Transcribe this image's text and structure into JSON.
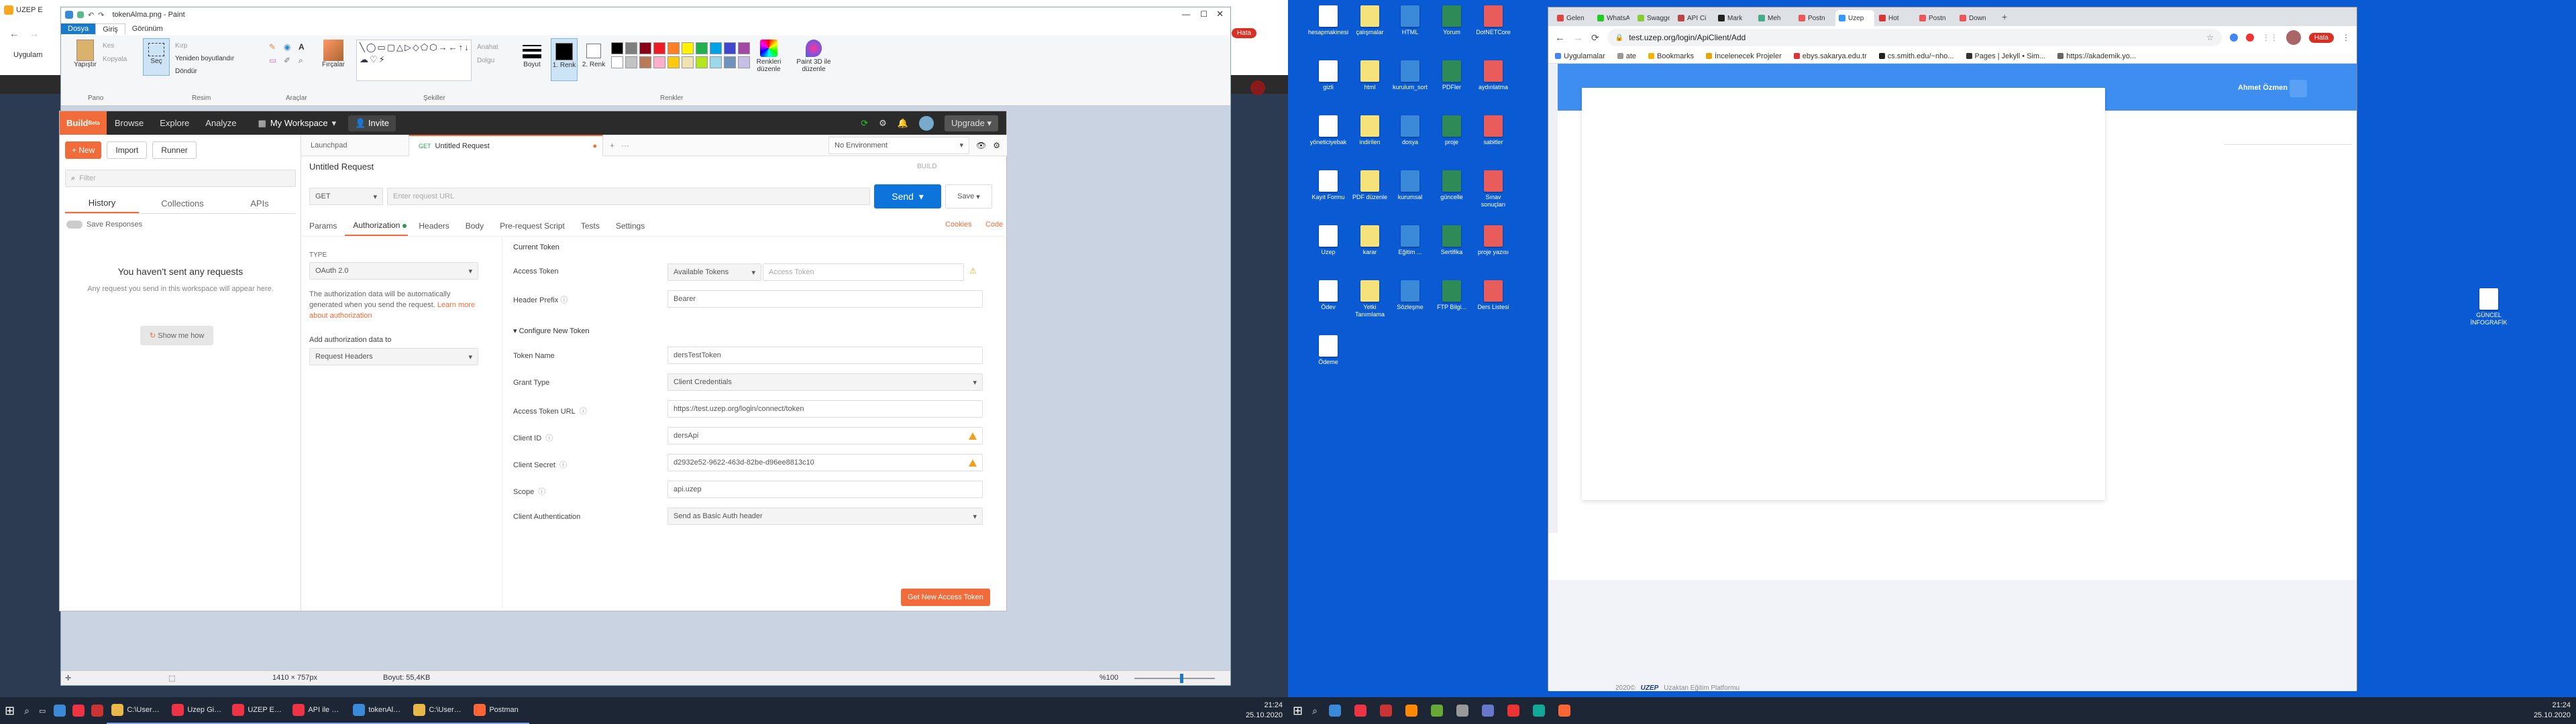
{
  "left_monitor": {
    "paint": {
      "title": "tokenAlma.png - Paint",
      "menu_file": "Dosya",
      "menu_home": "Giriş",
      "menu_view": "Görünüm",
      "clipboard": {
        "paste": "Yapıştır",
        "cut": "Kes",
        "copy": "Kopyala",
        "group": "Pano"
      },
      "image": {
        "select": "Seç",
        "crop": "Kırp",
        "resize": "Yeniden boyutlandır",
        "rotate": "Döndür",
        "group": "Resim"
      },
      "tools": {
        "group": "Araçlar",
        "brushes": "Fırçalar"
      },
      "shapes": {
        "outline": "Anahat",
        "fill": "Dolgu",
        "group": "Şekiller"
      },
      "size": "Boyut",
      "color1": "1. Renk",
      "color2": "2. Renk",
      "edit_colors": "Renkleri düzenle",
      "paint3d": "Paint 3D ile düzenle",
      "colors_group": "Renkler",
      "palette": [
        "#000000",
        "#7f7f7f",
        "#880015",
        "#ed1c24",
        "#ff7f27",
        "#fff200",
        "#22b14c",
        "#00a2e8",
        "#3f48cc",
        "#a349a4",
        "#ffffff",
        "#c3c3c3",
        "#b97a57",
        "#ffaec9",
        "#ffc90e",
        "#efe4b0",
        "#b5e61d",
        "#99d9ea",
        "#7092be",
        "#c8bfe7"
      ],
      "status": {
        "dimensions": "1410 × 757px",
        "size": "Boyut: 55,4KB",
        "zoom": "%100"
      }
    },
    "behind_browser": {
      "tab_title": "UZEP E",
      "bookmark": "Uygulam",
      "badge": "Hata"
    },
    "postman": {
      "topbar": {
        "build": "Build",
        "beta": "Beta",
        "browse": "Browse",
        "explore": "Explore",
        "analyze": "Analyze",
        "workspace": "My Workspace",
        "invite": "Invite",
        "upgrade": "Upgrade"
      },
      "sidebar": {
        "new": "New",
        "import": "Import",
        "runner": "Runner",
        "filter_placeholder": "Filter",
        "tab_history": "History",
        "tab_collections": "Collections",
        "tab_apis": "APIs",
        "save_responses": "Save Responses",
        "empty_title": "You haven't sent any requests",
        "empty_body": "Any request you send in this workspace will appear here.",
        "show_me": "Show me how"
      },
      "tabs": {
        "launchpad": "Launchpad",
        "request_method": "GET",
        "request_tab": "Untitled Request",
        "env": "No Environment"
      },
      "request": {
        "name": "Untitled Request",
        "build": "BUILD",
        "method": "GET",
        "url_placeholder": "Enter request URL",
        "send": "Send",
        "save": "Save"
      },
      "subtabs": [
        "Params",
        "Authorization",
        "Headers",
        "Body",
        "Pre-request Script",
        "Tests",
        "Settings"
      ],
      "links": {
        "cookies": "Cookies",
        "code": "Code"
      },
      "auth": {
        "type_label": "TYPE",
        "type_value": "OAuth 2.0",
        "note": "The authorization data will be automatically generated when you send the request.",
        "learn_more": "Learn more about authorization",
        "add_to_label": "Add authorization data to",
        "add_to_value": "Request Headers"
      },
      "token": {
        "current": "Current Token",
        "access_token": "Access Token",
        "available_tokens": "Available Tokens",
        "access_token_placeholder": "Access Token",
        "header_prefix": "Header Prefix",
        "header_prefix_value": "Bearer",
        "configure": "Configure New Token",
        "fields": [
          {
            "label": "Token Name",
            "value": "dersTestToken",
            "kind": "input",
            "info": false,
            "warn": false
          },
          {
            "label": "Grant Type",
            "value": "Client Credentials",
            "kind": "select",
            "info": false,
            "warn": false
          },
          {
            "label": "Access Token URL",
            "value": "https://test.uzep.org/login/connect/token",
            "kind": "input",
            "info": true,
            "warn": false
          },
          {
            "label": "Client ID",
            "value": "dersApi",
            "kind": "input",
            "info": true,
            "warn": true
          },
          {
            "label": "Client Secret",
            "value": "d2932e52-9622-463d-82be-d96ee8813c10",
            "kind": "input",
            "info": true,
            "warn": true
          },
          {
            "label": "Scope",
            "value": "api.uzep",
            "kind": "input",
            "info": true,
            "warn": false
          },
          {
            "label": "Client Authentication",
            "value": "Send as Basic Auth header",
            "kind": "select",
            "info": false,
            "warn": false
          }
        ],
        "get_button": "Get New Access Token"
      }
    }
  },
  "taskbar_left": {
    "items": [
      "C:\\Users\\Sau...",
      "Uzep Giriş - G...",
      "UZEP Eğitim ...",
      "API ile Entegr...",
      "tokenAlma.p...",
      "C:\\Users\\Sau...",
      "Postman"
    ],
    "time": "21:24",
    "date": "25.10.2020"
  },
  "desktop_icons": [
    "hesapmakinesi",
    "çalışmalar",
    "HTML",
    "Yorum",
    "DotNETCore",
    "gizli",
    "html",
    "kurulum_sort",
    "PDFler",
    "aydınlatma",
    "yöneticiyebak",
    "indirilen",
    "dosya",
    "proje",
    "sabitler",
    "Kayıt Formu",
    "PDF düzenle",
    "kurumsal",
    "güncelle",
    "Sınav sonuçları",
    "Uzep",
    "karar",
    "Eğitim ...",
    "Sertifika",
    "proje yazısı",
    "Ödev",
    "Yetki Tanımlama",
    "Sözleşme",
    "FTP Bilgi...",
    "Ders Listesi",
    "Ödeme"
  ],
  "right_browser": {
    "tabs": [
      "Gelen",
      "WhatsApp",
      "Swagger",
      "API Ci",
      "Mark",
      "Meh",
      "Postn",
      "Uzep",
      "Hot",
      "Postn",
      "Down"
    ],
    "url": "test.uzep.org/login/ApiClient/Add",
    "bookmarks": [
      "Uygulamalar",
      "ate",
      "Bookmarks",
      "İncelenecek Projeler",
      "ebys.sakarya.edu.tr",
      "cs.smith.edu/~nho...",
      "Pages | Jekyll • Sim...",
      "https://akademik.yo..."
    ],
    "user": "Ahmet Özmen",
    "profile_badge": "Hata",
    "footer_year": "2020©",
    "footer_brand": "UZEP",
    "footer_text": "Uzaktan Eğitim Platformu"
  },
  "right_desktop_icon": "GÜNCEL İNFOGRAFİK",
  "taskbar_right": {
    "time": "21:24",
    "date": "25.10.2020"
  }
}
